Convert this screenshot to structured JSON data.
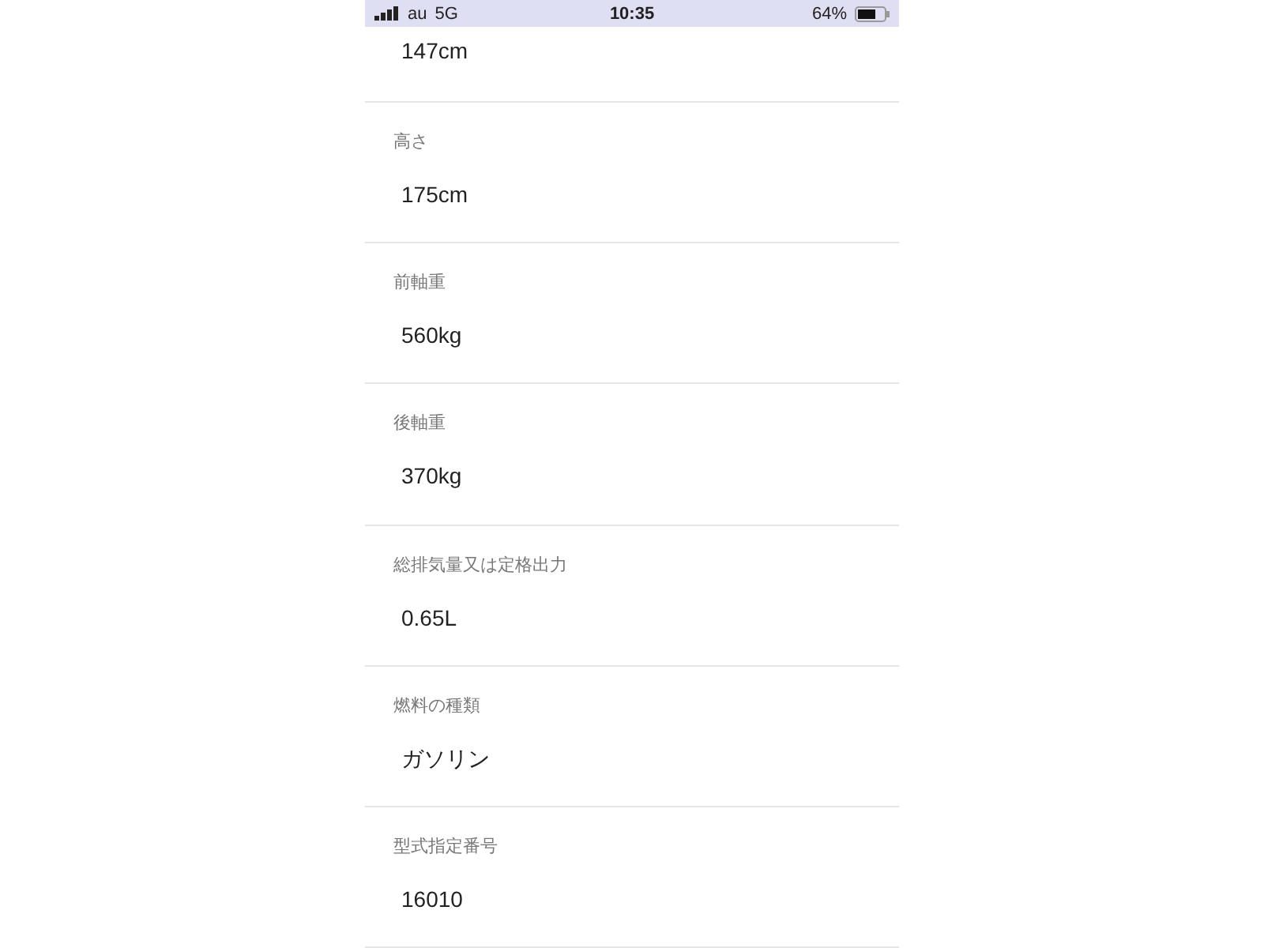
{
  "status_bar": {
    "carrier": "au",
    "network": "5G",
    "time": "10:35",
    "battery": "64%"
  },
  "fields": [
    {
      "value": "147cm"
    },
    {
      "label": "高さ",
      "value": "175cm"
    },
    {
      "label": "前軸重",
      "value": "560kg"
    },
    {
      "label": "後軸重",
      "value": "370kg"
    },
    {
      "label": "総排気量又は定格出力",
      "value": "0.65L"
    },
    {
      "label": "燃料の種類",
      "value": "ガソリン"
    },
    {
      "label": "型式指定番号",
      "value": "16010"
    }
  ]
}
